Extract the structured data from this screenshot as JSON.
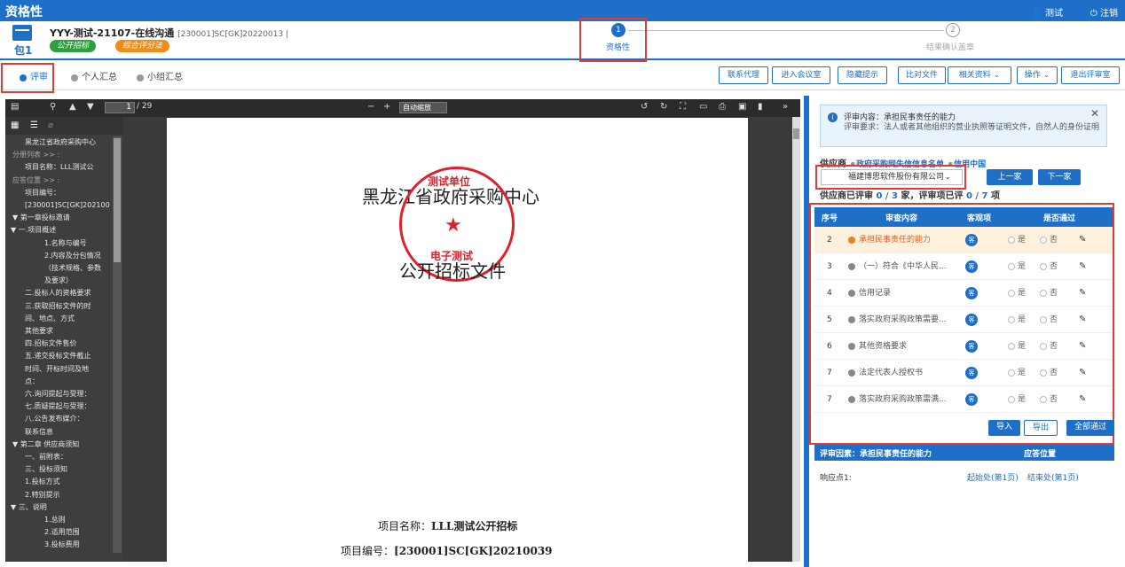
{
  "app": {
    "title": "资格性",
    "user": "测试",
    "logout": "注销"
  },
  "header": {
    "pkg": "包1",
    "title": "YYY-测试-21107-在线沟通",
    "code": "[230001]SC[GK]20220013 |",
    "tag1": "公开招标",
    "tag2": "综合评分法",
    "step1_num": "1",
    "step1": "资格性",
    "step2_num": "2",
    "step2": "结果确认盖章"
  },
  "tabs": [
    "评审",
    "个人汇总",
    "小组汇总"
  ],
  "toolbar": [
    "联系代理",
    "进入会议室",
    "隐藏提示",
    "比对文件",
    "相关资料",
    "操作",
    "退出评审室"
  ],
  "viewer": {
    "page_current": "1",
    "page_total": "/ 29",
    "zoom": "自动缩放",
    "outline": [
      {
        "t": "黑龙江省政府采购中心",
        "lvl": 2
      },
      {
        "t": "分册列表 >> :",
        "lvl": 0
      },
      {
        "t": "项目名称：LLL测试公",
        "lvl": 2
      },
      {
        "t": "应答位置 >> :",
        "lvl": 0
      },
      {
        "t": "项目编号：",
        "lvl": 2
      },
      {
        "t": "[230001]SC[GK]202100",
        "lvl": 2
      },
      {
        "t": "▼ 第一章投标邀请",
        "lvl": 0
      },
      {
        "t": "▼ 一.项目概述",
        "lvl": 1
      },
      {
        "t": "1.名称与编号",
        "lvl": 3
      },
      {
        "t": "2.内容及分包情况",
        "lvl": 3
      },
      {
        "t": "（技术规格、参数",
        "lvl": 3
      },
      {
        "t": "及要求）",
        "lvl": 3
      },
      {
        "t": "二.投标人的资格要求",
        "lvl": 2
      },
      {
        "t": "三.获取招标文件的时",
        "lvl": 2
      },
      {
        "t": "间、地点、方式",
        "lvl": 2
      },
      {
        "t": "其他要求",
        "lvl": 2
      },
      {
        "t": "四.招标文件售价",
        "lvl": 2
      },
      {
        "t": "五.递交投标文件截止",
        "lvl": 2
      },
      {
        "t": "时间、开标时间及地",
        "lvl": 2
      },
      {
        "t": "点：",
        "lvl": 2
      },
      {
        "t": "六.询问提起与受理：",
        "lvl": 2
      },
      {
        "t": "七.质疑提起与受理：",
        "lvl": 2
      },
      {
        "t": "八.公告发布媒介：",
        "lvl": 2
      },
      {
        "t": "联系信息",
        "lvl": 2
      },
      {
        "t": "▼ 第二章 供应商须知",
        "lvl": 0
      },
      {
        "t": "一、前附表：",
        "lvl": 2
      },
      {
        "t": "三、投标须知",
        "lvl": 2
      },
      {
        "t": "1.投标方式",
        "lvl": 2
      },
      {
        "t": "2.特别提示",
        "lvl": 2
      },
      {
        "t": "▼ 三、说明",
        "lvl": 1
      },
      {
        "t": "1.总则",
        "lvl": 3
      },
      {
        "t": "2.适用范围",
        "lvl": 3
      },
      {
        "t": "3.投标费用",
        "lvl": 3
      }
    ],
    "doc_title1": "黑龙江省政府采购中心",
    "doc_title2": "公开招标文件",
    "stamp_top": "测试单位",
    "stamp_star": "★",
    "stamp_bottom": "电子测试",
    "proj_name_label": "项目名称：",
    "proj_name": "LLL测试公开招标",
    "proj_code_label": "项目编号：",
    "proj_code": "[230001]SC[GK]20210039"
  },
  "review": {
    "notice_title": "评审内容：承担民事责任的能力",
    "notice_text": "评审要求：法人或者其他组织的营业执照等证明文件，自然人的身份证明",
    "supplier_label": "供应商",
    "link1": "政府采购网失信信息名单",
    "link2": "信用中国",
    "supplier_selected": "福建博思软件股份有限公司",
    "prev": "上一家",
    "next": "下一家",
    "count_pre": "供应商已评审",
    "count_a": "0 / 3",
    "count_mid": "家，评审项已评",
    "count_b": "0 / 7",
    "count_post": "项",
    "cols": [
      "序号",
      "审查内容",
      "客观项",
      "是否通过"
    ],
    "rows": [
      {
        "no": "2",
        "content": "承担民事责任的能力",
        "k": "客",
        "yes": "是",
        "no_l": "否",
        "selected": true
      },
      {
        "no": "3",
        "content": "（一）符合《中华人民...",
        "k": "客",
        "yes": "是",
        "no_l": "否"
      },
      {
        "no": "4",
        "content": "信用记录",
        "k": "客",
        "yes": "是",
        "no_l": "否"
      },
      {
        "no": "5",
        "content": "落实政府采购政策需要...",
        "k": "客",
        "yes": "是",
        "no_l": "否"
      },
      {
        "no": "6",
        "content": "其他资格要求",
        "k": "客",
        "yes": "是",
        "no_l": "否"
      },
      {
        "no": "7",
        "content": "法定代表人授权书",
        "k": "客",
        "yes": "是",
        "no_l": "否"
      },
      {
        "no": "7",
        "content": "落实政府采购政策需满...",
        "k": "客",
        "yes": "是",
        "no_l": "否"
      }
    ],
    "import": "导入",
    "export": "导出",
    "pass_all": "全部通过",
    "factor_label": "评审因素：承担民事责任的能力",
    "pos_label": "应答位置",
    "resp": "响应点1:",
    "start": "起始处(第1页)",
    "end": "结束处(第1页)"
  }
}
